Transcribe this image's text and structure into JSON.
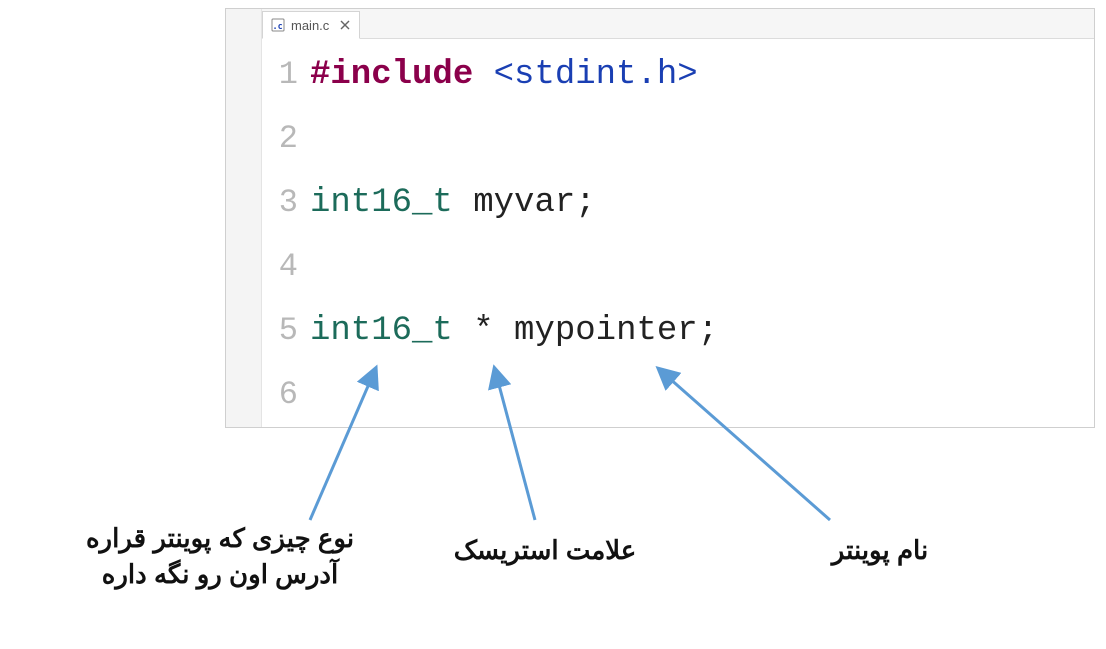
{
  "tab": {
    "filename": "main.c"
  },
  "code": {
    "lines": [
      {
        "n": "1",
        "tokens": [
          {
            "cls": "tok-preproc",
            "text": "#include"
          },
          {
            "cls": "",
            "text": " "
          },
          {
            "cls": "tok-header",
            "text": "<stdint.h>"
          }
        ]
      },
      {
        "n": "2",
        "tokens": []
      },
      {
        "n": "3",
        "tokens": [
          {
            "cls": "tok-type",
            "text": "int16_t"
          },
          {
            "cls": "",
            "text": " "
          },
          {
            "cls": "tok-ident",
            "text": "myvar"
          },
          {
            "cls": "tok-punct",
            "text": ";"
          }
        ]
      },
      {
        "n": "4",
        "tokens": []
      },
      {
        "n": "5",
        "tokens": [
          {
            "cls": "tok-type",
            "text": "int16_t"
          },
          {
            "cls": "",
            "text": " "
          },
          {
            "cls": "tok-punct",
            "text": "*"
          },
          {
            "cls": "",
            "text": " "
          },
          {
            "cls": "tok-ident",
            "text": "mypointer"
          },
          {
            "cls": "tok-punct",
            "text": ";"
          }
        ]
      },
      {
        "n": "6",
        "tokens": []
      }
    ]
  },
  "annotations": {
    "label_type": "نوع چیزی که پوینتر قراره آدرس اون رو نگه داره",
    "label_asterisk": "علامت استریسک",
    "label_name": "نام پوینتر"
  }
}
